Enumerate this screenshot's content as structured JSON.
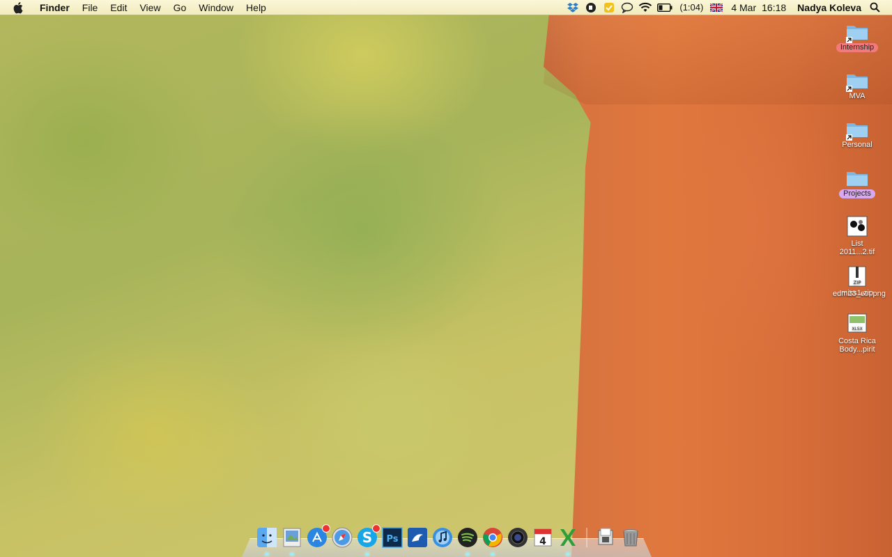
{
  "menubar": {
    "app_name": "Finder",
    "menus": [
      "File",
      "Edit",
      "View",
      "Go",
      "Window",
      "Help"
    ],
    "battery_text": "(1:04)",
    "date": "4 Mar",
    "time": "16:18",
    "user": "Nadya Koleva"
  },
  "desktop": {
    "items": [
      {
        "label": "Internship",
        "kind": "folder-alias",
        "tag": "red"
      },
      {
        "label": "MVA",
        "kind": "folder-alias",
        "tag": ""
      },
      {
        "label": "Personal",
        "kind": "folder-alias",
        "tag": ""
      },
      {
        "label": "Projects",
        "kind": "folder",
        "tag": "purple"
      },
      {
        "label": "List 2011...2.tif",
        "kind": "image-file",
        "tag": ""
      },
      {
        "label": "edm23_est.png / miss1.zip",
        "kind": "zip-file",
        "tag": ""
      },
      {
        "label": "Costa Rica Body...pirit",
        "kind": "xlsx-file",
        "tag": ""
      }
    ],
    "item_lines": {
      "list_l1": "List",
      "list_l2": "2011...2.tif",
      "zip_l1": "edm23_est.png",
      "zip_l2": "miss1.zip",
      "costa_l1": "Costa Rica",
      "costa_l2": "Body...pirit"
    }
  },
  "dock": {
    "calendar_day": "4"
  },
  "colors": {
    "menubar_bg": "#f6f1c9",
    "tag_red": "#f27a7a",
    "tag_purple": "#d8a8ee",
    "folder_blue": "#8ec3ea"
  }
}
